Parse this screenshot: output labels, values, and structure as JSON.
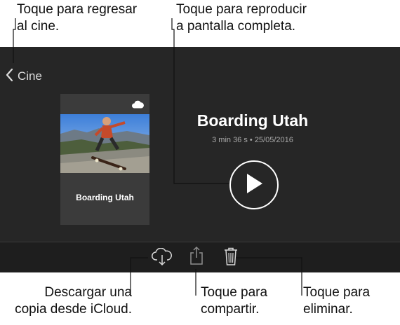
{
  "callouts": {
    "back": [
      "Toque para regresar",
      "al cine."
    ],
    "play": [
      "Toque para reproducir",
      "a pantalla completa."
    ],
    "download": [
      "Descargar una",
      "copia desde iCloud."
    ],
    "share": [
      "Toque para",
      "compartir."
    ],
    "delete": [
      "Toque para",
      "eliminar."
    ]
  },
  "nav": {
    "back_label": "Cine"
  },
  "movie": {
    "title": "Boarding Utah",
    "card_title": "Boarding Utah",
    "meta": "3 min 36 s • 25/05/2016"
  },
  "icons": {
    "back": "chevron-left-icon",
    "cloud": "cloud-icon",
    "play": "play-icon",
    "download": "cloud-download-icon",
    "share": "share-icon",
    "delete": "trash-icon"
  },
  "colors": {
    "screen_bg": "#262626",
    "toolbar_bg": "#1e1e1e",
    "card_bg": "#3b3b3b",
    "text_primary": "#ffffff",
    "text_secondary": "#a8a8a8"
  }
}
